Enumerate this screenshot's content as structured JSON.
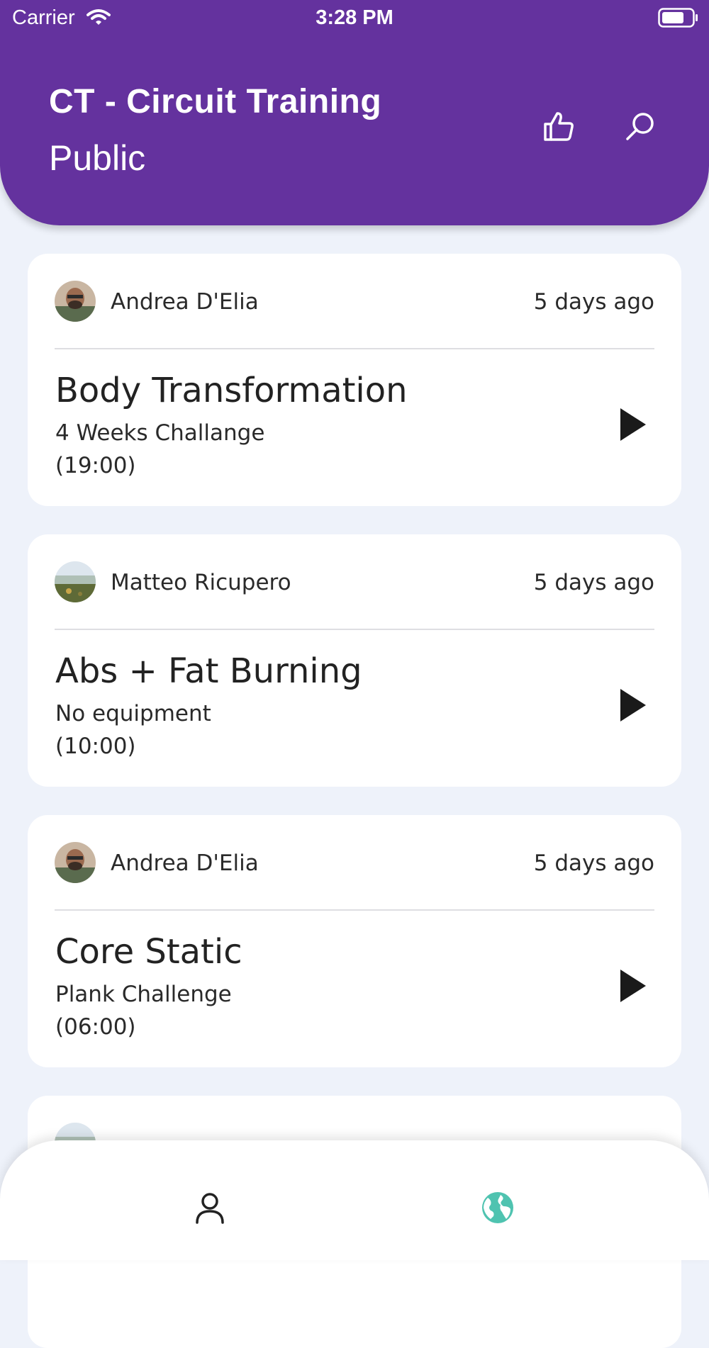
{
  "status_bar": {
    "carrier": "Carrier",
    "time": "3:28 PM"
  },
  "header": {
    "title": "CT - Circuit Training",
    "subtitle": "Public",
    "like_icon": "thumbs-up-icon",
    "search_icon": "search-icon",
    "background_color": "#64329E"
  },
  "workouts": [
    {
      "author": "Andrea D'Elia",
      "posted": "5 days ago",
      "title": "Body Transformation",
      "description": "4 Weeks Challange",
      "duration": "(19:00)",
      "avatar": "man-portrait-avatar"
    },
    {
      "author": "Matteo Ricupero",
      "posted": "5 days ago",
      "title": "Abs + Fat Burning",
      "description": "No equipment",
      "duration": "(10:00)",
      "avatar": "landscape-avatar"
    },
    {
      "author": "Andrea D'Elia",
      "posted": "5 days ago",
      "title": "Core Static",
      "description": "Plank Challenge",
      "duration": "(06:00)",
      "avatar": "man-portrait-avatar"
    }
  ],
  "tab_bar": {
    "tabs": [
      {
        "name": "profile",
        "icon": "person-icon",
        "active": false
      },
      {
        "name": "public",
        "icon": "globe-icon",
        "active": true,
        "color": "#4FC3B0"
      }
    ]
  }
}
